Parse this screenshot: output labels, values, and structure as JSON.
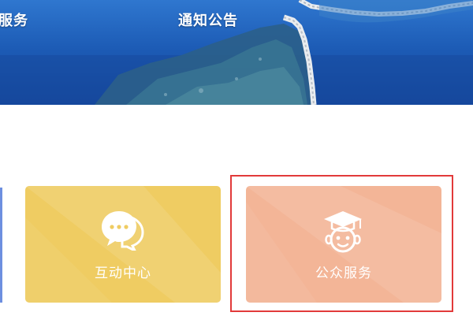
{
  "banner": {
    "nav_left_label": "服务",
    "nav_notice_label": "通知公告"
  },
  "cards": [
    {
      "label": "互动中心",
      "icon": "chat-bubbles-icon",
      "color": "#efcc62"
    },
    {
      "label": "公众服务",
      "icon": "graduate-face-icon",
      "color": "#f3b597"
    }
  ],
  "highlight_color": "#e23a3a"
}
